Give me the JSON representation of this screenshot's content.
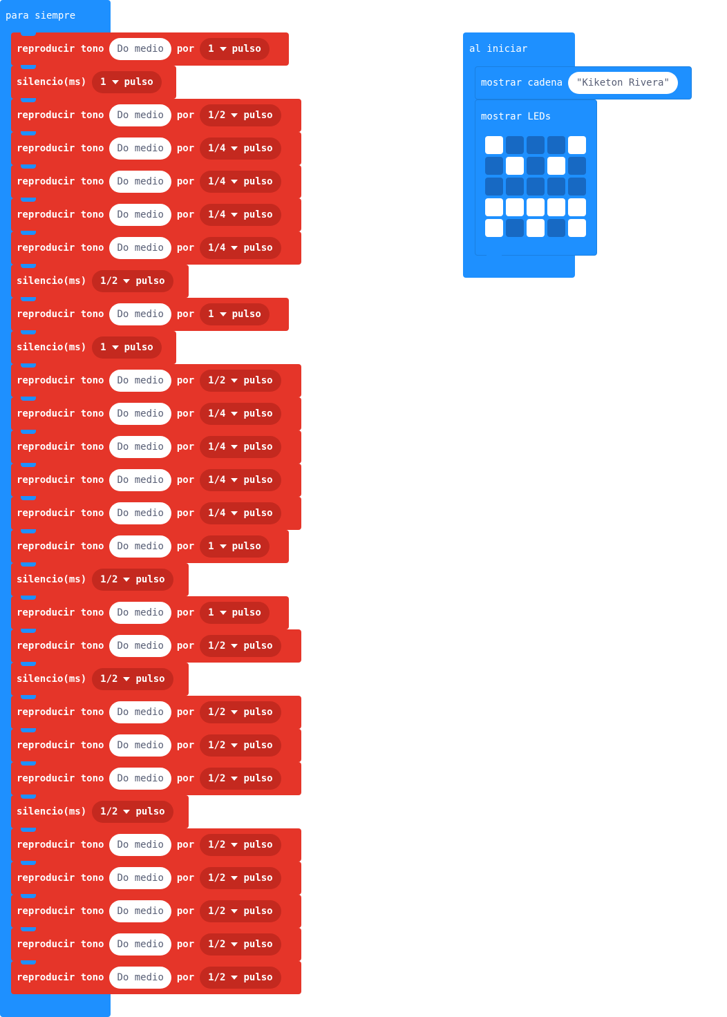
{
  "forever": {
    "label": "para siempre",
    "blocks": [
      {
        "kind": "play",
        "note": "Do medio",
        "beat": "1",
        "pulse": "pulso"
      },
      {
        "kind": "rest",
        "beat": "1",
        "pulse": "pulso"
      },
      {
        "kind": "play",
        "note": "Do medio",
        "beat": "1/2",
        "pulse": "pulso"
      },
      {
        "kind": "play",
        "note": "Do medio",
        "beat": "1/4",
        "pulse": "pulso"
      },
      {
        "kind": "play",
        "note": "Do medio",
        "beat": "1/4",
        "pulse": "pulso"
      },
      {
        "kind": "play",
        "note": "Do medio",
        "beat": "1/4",
        "pulse": "pulso"
      },
      {
        "kind": "play",
        "note": "Do medio",
        "beat": "1/4",
        "pulse": "pulso"
      },
      {
        "kind": "rest",
        "beat": "1/2",
        "pulse": "pulso"
      },
      {
        "kind": "play",
        "note": "Do medio",
        "beat": "1",
        "pulse": "pulso"
      },
      {
        "kind": "rest",
        "beat": "1",
        "pulse": "pulso"
      },
      {
        "kind": "play",
        "note": "Do medio",
        "beat": "1/2",
        "pulse": "pulso"
      },
      {
        "kind": "play",
        "note": "Do medio",
        "beat": "1/4",
        "pulse": "pulso"
      },
      {
        "kind": "play",
        "note": "Do medio",
        "beat": "1/4",
        "pulse": "pulso"
      },
      {
        "kind": "play",
        "note": "Do medio",
        "beat": "1/4",
        "pulse": "pulso"
      },
      {
        "kind": "play",
        "note": "Do medio",
        "beat": "1/4",
        "pulse": "pulso"
      },
      {
        "kind": "play",
        "note": "Do medio",
        "beat": "1",
        "pulse": "pulso"
      },
      {
        "kind": "rest",
        "beat": "1/2",
        "pulse": "pulso"
      },
      {
        "kind": "play",
        "note": "Do medio",
        "beat": "1",
        "pulse": "pulso"
      },
      {
        "kind": "play",
        "note": "Do medio",
        "beat": "1/2",
        "pulse": "pulso"
      },
      {
        "kind": "rest",
        "beat": "1/2",
        "pulse": "pulso"
      },
      {
        "kind": "play",
        "note": "Do medio",
        "beat": "1/2",
        "pulse": "pulso"
      },
      {
        "kind": "play",
        "note": "Do medio",
        "beat": "1/2",
        "pulse": "pulso"
      },
      {
        "kind": "play",
        "note": "Do medio",
        "beat": "1/2",
        "pulse": "pulso"
      },
      {
        "kind": "rest",
        "beat": "1/2",
        "pulse": "pulso"
      },
      {
        "kind": "play",
        "note": "Do medio",
        "beat": "1/2",
        "pulse": "pulso"
      },
      {
        "kind": "play",
        "note": "Do medio",
        "beat": "1/2",
        "pulse": "pulso"
      },
      {
        "kind": "play",
        "note": "Do medio",
        "beat": "1/2",
        "pulse": "pulso"
      },
      {
        "kind": "play",
        "note": "Do medio",
        "beat": "1/2",
        "pulse": "pulso"
      },
      {
        "kind": "play",
        "note": "Do medio",
        "beat": "1/2",
        "pulse": "pulso"
      }
    ],
    "play_label": "reproducir tono",
    "for_label": "por",
    "rest_label": "silencio(ms)"
  },
  "onstart": {
    "label": "al iniciar",
    "show_string_label": "mostrar cadena",
    "show_string_value": "\"Kiketon Rivera\"",
    "show_leds_label": "mostrar LEDs",
    "leds": [
      [
        1,
        0,
        0,
        0,
        1
      ],
      [
        0,
        1,
        0,
        1,
        0
      ],
      [
        0,
        0,
        0,
        0,
        0
      ],
      [
        1,
        1,
        1,
        1,
        1
      ],
      [
        1,
        0,
        1,
        0,
        1
      ]
    ]
  },
  "colors": {
    "event_blue": "#1e90ff",
    "music_red": "#e53529",
    "dropdown_red": "#c4291f",
    "led_off": "#1769c3",
    "led_on": "#ffffff"
  }
}
